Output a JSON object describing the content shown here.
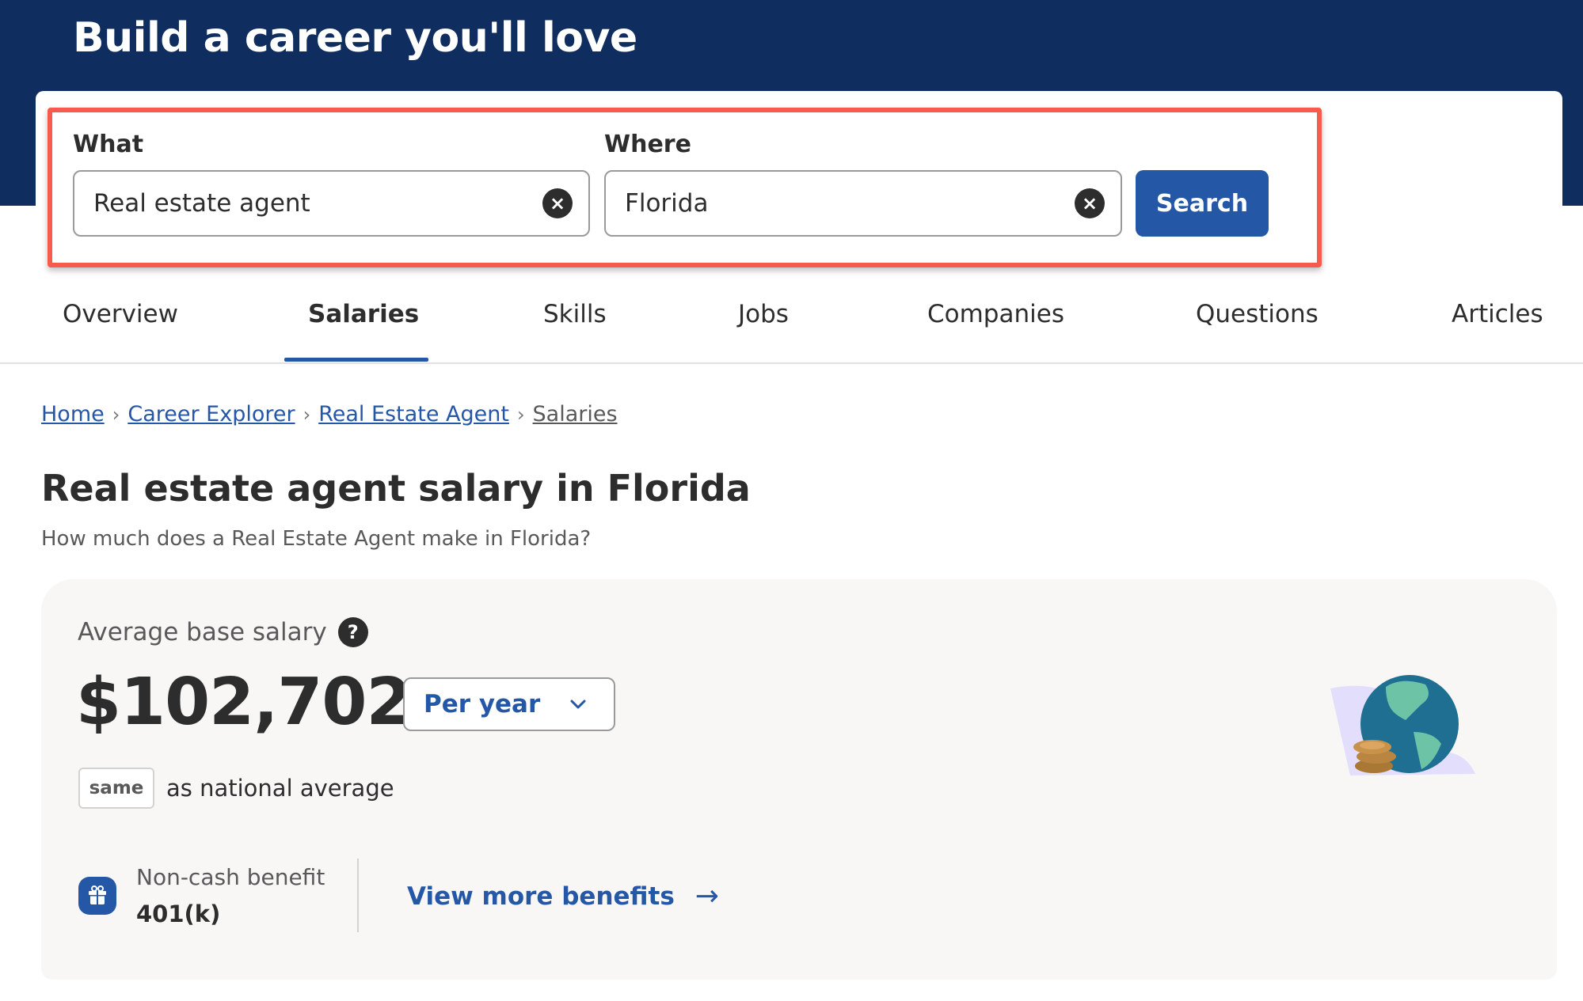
{
  "banner": {
    "title": "Build a career you'll love"
  },
  "search": {
    "what_label": "What",
    "what_value": "Real estate agent",
    "where_label": "Where",
    "where_value": "Florida",
    "clear_icon": "×",
    "search_label": "Search"
  },
  "tabs": [
    {
      "label": "Overview",
      "active": false
    },
    {
      "label": "Salaries",
      "active": true
    },
    {
      "label": "Skills",
      "active": false
    },
    {
      "label": "Jobs",
      "active": false
    },
    {
      "label": "Companies",
      "active": false
    },
    {
      "label": "Questions",
      "active": false
    },
    {
      "label": "Articles",
      "active": false
    }
  ],
  "breadcrumb": {
    "items": [
      "Home",
      "Career Explorer",
      "Real Estate Agent",
      "Salaries"
    ],
    "separator": "›"
  },
  "page": {
    "title": "Real estate agent salary in Florida",
    "subtitle": "How much does a Real Estate Agent make in Florida?"
  },
  "salary": {
    "label": "Average base salary",
    "help_icon": "?",
    "amount": "$102,702",
    "period": "Per year",
    "chevron": "⌄",
    "comparison_badge": "same",
    "comparison_text": "as national average",
    "benefit_label": "Non-cash benefit",
    "benefit_value": "401(k)",
    "view_more_label": "View more benefits",
    "arrow": "→"
  },
  "colors": {
    "banner": "#0f2d5e",
    "accent": "#2557a7",
    "highlight": "#f95a4e",
    "card_bg": "#f8f7f6"
  }
}
